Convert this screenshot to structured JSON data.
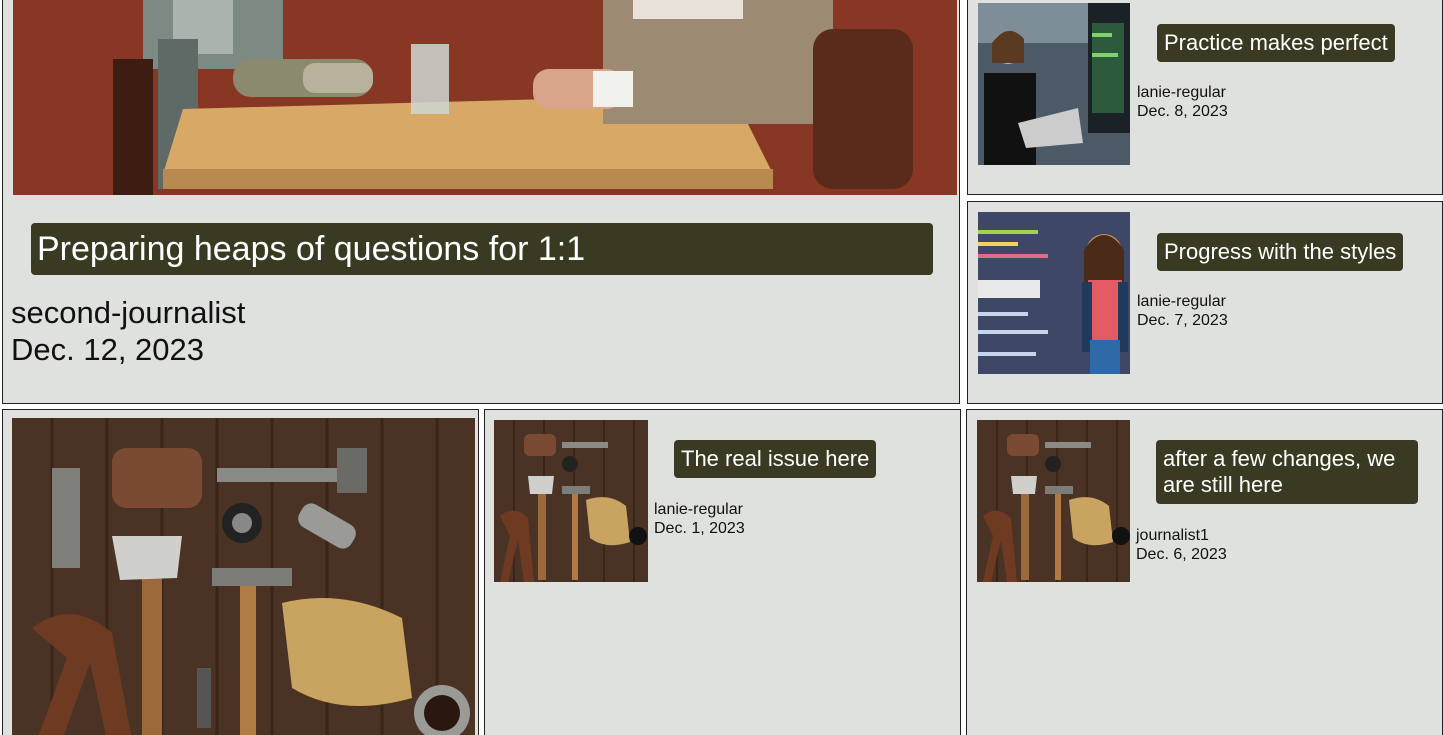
{
  "featured": {
    "title": "Preparing heaps of questions for 1:1",
    "author": "second-journalist",
    "date": "Dec. 12, 2023",
    "image_icon": "robot-interview-image"
  },
  "posts": [
    {
      "title": "Practice makes perfect",
      "author": "lanie-regular",
      "date": "Dec. 8, 2023",
      "image_icon": "developer-monitors-image"
    },
    {
      "title": "Progress with the styles",
      "author": "lanie-regular",
      "date": "Dec. 7, 2023",
      "image_icon": "code-woman-image"
    },
    {
      "title": "The real issue here",
      "author": "lanie-regular",
      "date": "Dec. 1, 2023",
      "image_icon": "tools-image"
    },
    {
      "title": "after a few changes, we are still here",
      "author": "journalist1",
      "date": "Dec. 6, 2023",
      "image_icon": "tools-image"
    }
  ],
  "large_card": {
    "image_icon": "tools-image"
  },
  "colors": {
    "card_bg": "#dfe1de",
    "tag_bg": "#3a3a22",
    "tag_text": "#ffffff",
    "border": "#222222"
  }
}
